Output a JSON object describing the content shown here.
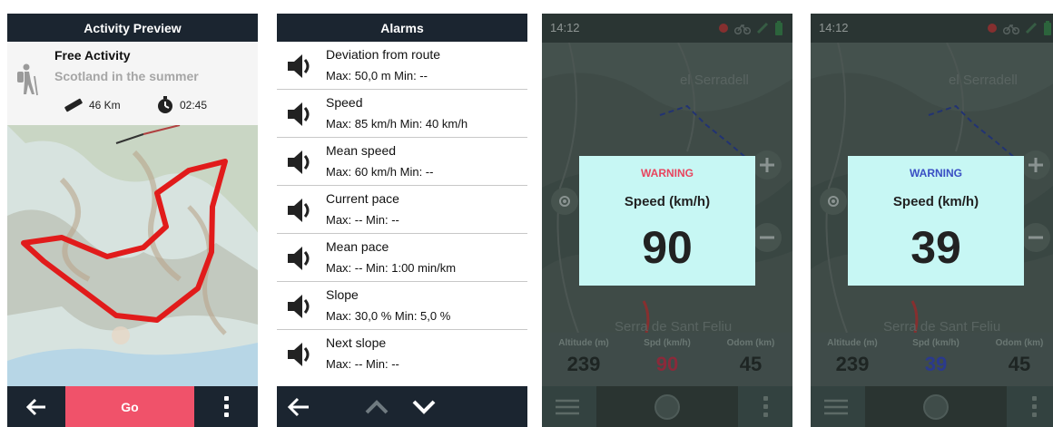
{
  "screens": {
    "activity": {
      "title": "Activity Preview",
      "activity_name": "Free Activity",
      "route_name": "Scotland in the summer",
      "distance": "46 Km",
      "duration": "02:45",
      "go_label": "Go",
      "accent": "#f0526a"
    },
    "alarms": {
      "title": "Alarms",
      "items": [
        {
          "name": "Deviation from route",
          "values": "Max: 50,0 m  Min: --"
        },
        {
          "name": "Speed",
          "values": "Max: 85 km/h  Min: 40 km/h"
        },
        {
          "name": "Mean speed",
          "values": "Max: 60 km/h  Min: --"
        },
        {
          "name": "Current pace",
          "values": "Max: --  Min: --"
        },
        {
          "name": "Mean pace",
          "values": "Max: --  Min: 1:00 min/km"
        },
        {
          "name": "Slope",
          "values": "Max: 30,0 %  Min: 5,0 %"
        },
        {
          "name": "Next slope",
          "values": "Max: --  Min: --"
        }
      ]
    },
    "warning_high": {
      "time": "14:12",
      "map_label_top": "el Serradell",
      "map_label_bottom": "Serra de Sant Feliu",
      "warning": "WARNING",
      "warning_color": "#e8455e",
      "label": "Speed (km/h)",
      "value": "90",
      "fields": [
        {
          "label": "Altitude (m)",
          "value": "239"
        },
        {
          "label": "Spd (km/h)",
          "value": "90"
        },
        {
          "label": "Odom (km)",
          "value": "45"
        }
      ]
    },
    "warning_low": {
      "time": "14:12",
      "map_label_top": "el Serradell",
      "map_label_bottom": "Serra de Sant Feliu",
      "warning": "WARNING",
      "warning_color": "#3a4fc4",
      "label": "Speed (km/h)",
      "value": "39",
      "fields": [
        {
          "label": "Altitude (m)",
          "value": "239"
        },
        {
          "label": "Spd (km/h)",
          "value": "39"
        },
        {
          "label": "Odom (km)",
          "value": "45"
        }
      ]
    }
  }
}
